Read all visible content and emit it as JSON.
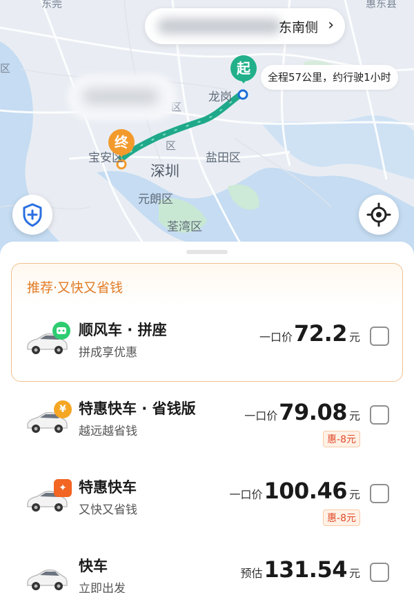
{
  "map": {
    "labels": {
      "longgang": "龙岗",
      "yantian": "盐田区",
      "shenzhen": "深圳",
      "baoan": "宝安区",
      "yuenlong": "元朗区",
      "tsuenwan": "荃湾区",
      "top_left": "东莞",
      "top_right": "惠东县",
      "left_mark": "区",
      "mid_mark": "区",
      "mid_mark2": "区",
      "top_mid": "布吉阳区"
    },
    "address_suffix": "东南侧",
    "start_marker": "起",
    "end_marker": "终",
    "route_summary": "全程57公里，约行驶1小时"
  },
  "recommend": {
    "title": "推荐·又快又省钱"
  },
  "options": [
    {
      "name": "顺风车 · 拼座",
      "subtitle": "拼成享优惠",
      "price_prefix": "一口价",
      "price": "72.2",
      "unit": "元",
      "discount": "",
      "badge_color": "#2ecc71",
      "checked": false
    },
    {
      "name": "特惠快车 · 省钱版",
      "subtitle": "越远越省钱",
      "price_prefix": "一口价",
      "price": "79.08",
      "unit": "元",
      "discount": "惠-8元",
      "badge_color": "#f5a623",
      "badge_glyph": "¥",
      "checked": false
    },
    {
      "name": "特惠快车",
      "subtitle": "又快又省钱",
      "price_prefix": "一口价",
      "price": "100.46",
      "unit": "元",
      "discount": "惠-8元",
      "badge_color": "#f26522",
      "badge_glyph": "✦",
      "checked": false
    },
    {
      "name": "快车",
      "subtitle": "立即出发",
      "price_prefix": "预估",
      "price": "131.54",
      "unit": "元",
      "discount": "",
      "checked": false
    }
  ],
  "colors": {
    "route": "#1fa98a",
    "accent_orange": "#e07b25",
    "start": "#21b08a",
    "end": "#f39a2d"
  }
}
